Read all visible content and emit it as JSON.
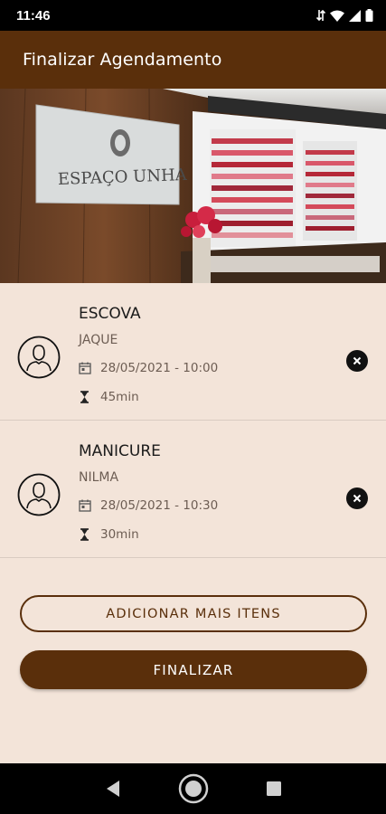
{
  "status_bar": {
    "time": "11:46"
  },
  "app_bar": {
    "title": "Finalizar Agendamento"
  },
  "hero": {
    "brand": "ESPAÇO UNHA"
  },
  "services": [
    {
      "name": "ESCOVA",
      "professional": "JAQUE",
      "datetime": "28/05/2021 - 10:00",
      "duration": "45min"
    },
    {
      "name": "MANICURE",
      "professional": "NILMA",
      "datetime": "28/05/2021 - 10:30",
      "duration": "30min"
    }
  ],
  "actions": {
    "add_label": "ADICIONAR MAIS ITENS",
    "finish_label": "FINALIZAR"
  },
  "colors": {
    "primary": "#5a2f0b",
    "background": "#f3e4d9",
    "text_muted": "#6d5d53"
  },
  "icons": {
    "avatar": "user-outline-icon",
    "date": "calendar-icon",
    "duration": "hourglass-icon",
    "remove": "close-circle-icon"
  }
}
